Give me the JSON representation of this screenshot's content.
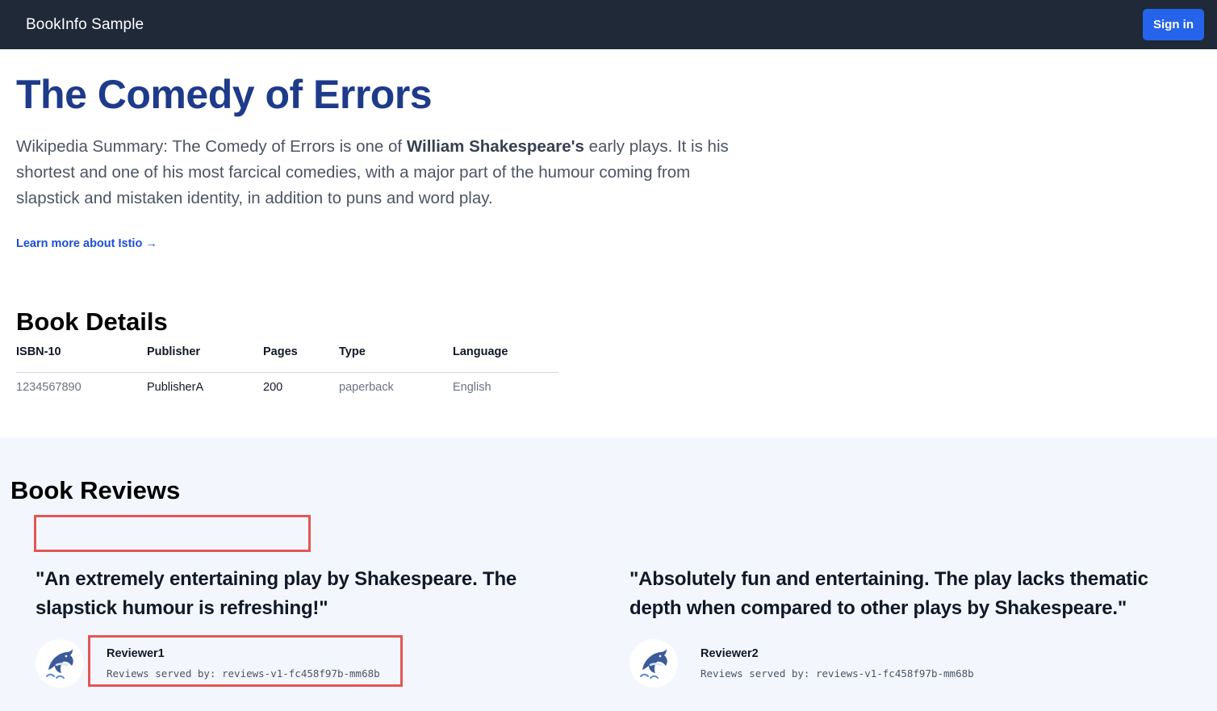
{
  "navbar": {
    "brand": "BookInfo Sample",
    "signin_label": "Sign in"
  },
  "book": {
    "title": "The Comedy of Errors",
    "summary_prefix": "Wikipedia Summary: The Comedy of Errors is one of ",
    "summary_author": "William Shakespeare's",
    "summary_suffix": " early plays. It is his shortest and one of his most farcical comedies, with a major part of the humour coming from slapstick and mistaken identity, in addition to puns and word play.",
    "learn_more": "Learn more about Istio →"
  },
  "details": {
    "heading": "Book Details",
    "columns": [
      "ISBN-10",
      "Publisher",
      "Pages",
      "Type",
      "Language"
    ],
    "row": [
      "1234567890",
      "PublisherA",
      "200",
      "paperback",
      "English"
    ]
  },
  "reviews": {
    "heading": "Book Reviews",
    "items": [
      {
        "quote": "\"An extremely entertaining play by Shakespeare. The slapstick humour is refreshing!\"",
        "reviewer": "Reviewer1",
        "served_by": "Reviews served by: reviews-v1-fc458f97b-mm68b"
      },
      {
        "quote": "\"Absolutely fun and entertaining. The play lacks thematic depth when compared to other plays by Shakespeare.\"",
        "reviewer": "Reviewer2",
        "served_by": "Reviews served by: reviews-v1-fc458f97b-mm68b"
      }
    ]
  },
  "colors": {
    "navbar_bg": "#1f2937",
    "accent": "#2563eb",
    "title": "#1e3a8a",
    "reviews_bg": "#f3f6fd",
    "highlight": "#e35656"
  },
  "icons": {
    "avatar": "dolphin-icon"
  }
}
